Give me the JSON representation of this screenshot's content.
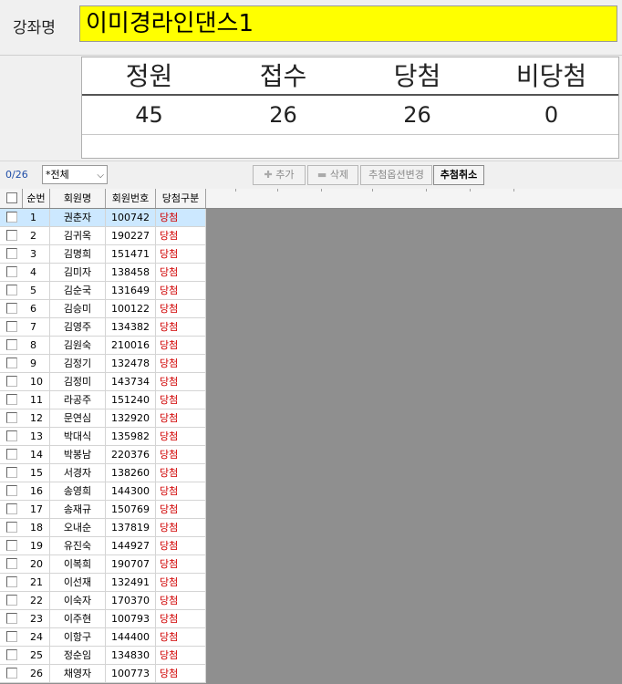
{
  "course": {
    "label": "강좌명",
    "name": "이미경라인댄스1"
  },
  "summary": {
    "headers": [
      "정원",
      "접수",
      "당첨",
      "비당첨"
    ],
    "values": [
      "45",
      "26",
      "26",
      "0"
    ]
  },
  "toolbar": {
    "count": "0/26",
    "filter": "*전체",
    "add_label": "추가",
    "delete_label": "삭제",
    "change_option_label": "추첨옵션변경",
    "cancel_draw_label": "추첨취소"
  },
  "grid": {
    "columns": [
      "순번",
      "회원명",
      "회원번호",
      "당첨구분"
    ],
    "rows": [
      {
        "no": "1",
        "name": "권춘자",
        "id": "100742",
        "status": "당첨"
      },
      {
        "no": "2",
        "name": "김귀옥",
        "id": "190227",
        "status": "당첨"
      },
      {
        "no": "3",
        "name": "김명희",
        "id": "151471",
        "status": "당첨"
      },
      {
        "no": "4",
        "name": "김미자",
        "id": "138458",
        "status": "당첨"
      },
      {
        "no": "5",
        "name": "김순국",
        "id": "131649",
        "status": "당첨"
      },
      {
        "no": "6",
        "name": "김승미",
        "id": "100122",
        "status": "당첨"
      },
      {
        "no": "7",
        "name": "김영주",
        "id": "134382",
        "status": "당첨"
      },
      {
        "no": "8",
        "name": "김원숙",
        "id": "210016",
        "status": "당첨"
      },
      {
        "no": "9",
        "name": "김정기",
        "id": "132478",
        "status": "당첨"
      },
      {
        "no": "10",
        "name": "김정미",
        "id": "143734",
        "status": "당첨"
      },
      {
        "no": "11",
        "name": "라공주",
        "id": "151240",
        "status": "당첨"
      },
      {
        "no": "12",
        "name": "문연심",
        "id": "132920",
        "status": "당첨"
      },
      {
        "no": "13",
        "name": "박대식",
        "id": "135982",
        "status": "당첨"
      },
      {
        "no": "14",
        "name": "박봉남",
        "id": "220376",
        "status": "당첨"
      },
      {
        "no": "15",
        "name": "서경자",
        "id": "138260",
        "status": "당첨"
      },
      {
        "no": "16",
        "name": "송영희",
        "id": "144300",
        "status": "당첨"
      },
      {
        "no": "17",
        "name": "송재규",
        "id": "150769",
        "status": "당첨"
      },
      {
        "no": "18",
        "name": "오내순",
        "id": "137819",
        "status": "당첨"
      },
      {
        "no": "19",
        "name": "유진숙",
        "id": "144927",
        "status": "당첨"
      },
      {
        "no": "20",
        "name": "이복희",
        "id": "190707",
        "status": "당첨"
      },
      {
        "no": "21",
        "name": "이선재",
        "id": "132491",
        "status": "당첨"
      },
      {
        "no": "22",
        "name": "이숙자",
        "id": "170370",
        "status": "당첨"
      },
      {
        "no": "23",
        "name": "이주현",
        "id": "100793",
        "status": "당첨"
      },
      {
        "no": "24",
        "name": "이항구",
        "id": "144400",
        "status": "당첨"
      },
      {
        "no": "25",
        "name": "정순임",
        "id": "134830",
        "status": "당첨"
      },
      {
        "no": "26",
        "name": "채영자",
        "id": "100773",
        "status": "당첨"
      }
    ]
  }
}
